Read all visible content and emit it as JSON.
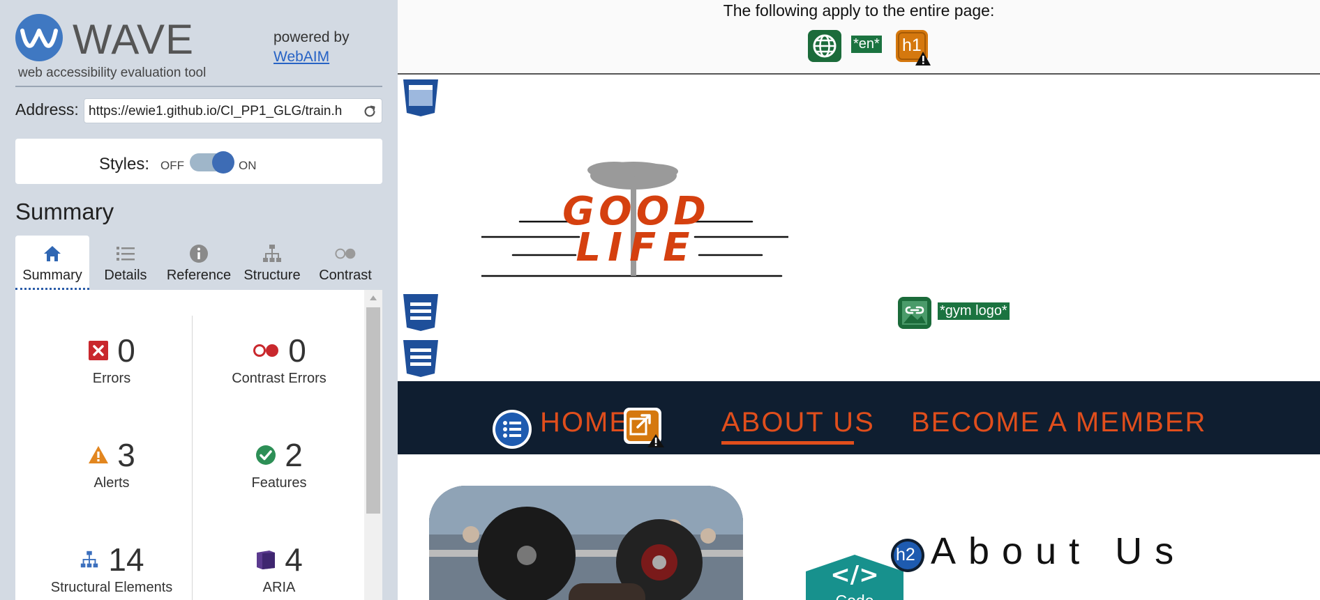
{
  "wave": {
    "wordmark": "WAVE",
    "tagline": "web accessibility evaluation tool",
    "powered_by": "powered by",
    "webaim_link": "WebAIM",
    "address_label": "Address:",
    "address_value": "https://ewie1.github.io/CI_PP1_GLG/train.h",
    "styles_label": "Styles:",
    "styles_off": "OFF",
    "styles_on": "ON",
    "summary_heading": "Summary",
    "tabs": [
      {
        "label": "Summary",
        "icon": "home-icon",
        "active": true
      },
      {
        "label": "Details",
        "icon": "list-icon",
        "active": false
      },
      {
        "label": "Reference",
        "icon": "info-icon",
        "active": false
      },
      {
        "label": "Structure",
        "icon": "hierarchy-icon",
        "active": false
      },
      {
        "label": "Contrast",
        "icon": "contrast-icon",
        "active": false
      }
    ],
    "stats": {
      "errors": {
        "value": "0",
        "label": "Errors"
      },
      "contrast_errors": {
        "value": "0",
        "label": "Contrast Errors"
      },
      "alerts": {
        "value": "3",
        "label": "Alerts"
      },
      "features": {
        "value": "2",
        "label": "Features"
      },
      "structural": {
        "value": "14",
        "label": "Structural Elements"
      },
      "aria": {
        "value": "4",
        "label": "ARIA"
      }
    },
    "colors": {
      "error": "#c9282d",
      "alert": "#e2861f",
      "feature": "#2d8f56",
      "structure": "#3b6fbd",
      "aria": "#5b3a8f",
      "panel_bg": "#d3dae3"
    }
  },
  "preview": {
    "banner_text": "The following apply to the entire page:",
    "lang_tag": "*en*",
    "h1_badge": "h1",
    "logo_tag": "*gym logo*",
    "logo_words": {
      "line1": "GOOD",
      "line2": "LIFE"
    },
    "nav": {
      "home": "HOME",
      "about": "ABOUT US",
      "member": "BECOME A MEMBER"
    },
    "h2_badge": "h2",
    "about_heading": "About Us",
    "code_badge": "Code",
    "code_glyph": "</>",
    "colors": {
      "nav_bg": "#0f1e30",
      "nav_link": "#e04e1c",
      "tag_bg": "#1b7340"
    }
  }
}
